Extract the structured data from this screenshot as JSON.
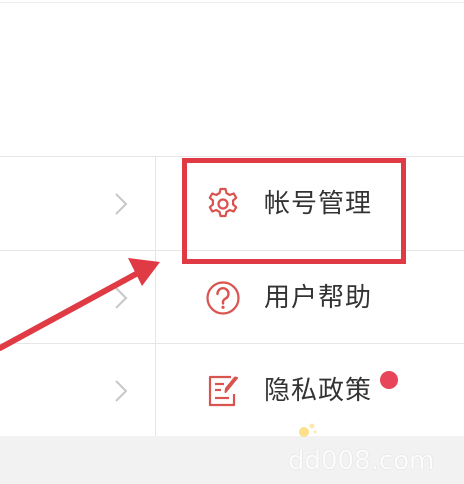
{
  "menu": {
    "items": [
      {
        "label": "帐号管理",
        "icon": "gear-icon",
        "highlighted": true
      },
      {
        "label": "用户帮助",
        "icon": "help-circle-icon"
      },
      {
        "label": "隐私政策",
        "icon": "document-edit-icon",
        "badge": "red-dot"
      }
    ]
  },
  "colors": {
    "accent": "#d9534f",
    "highlight": "#e03a44",
    "badge": "#e8455a"
  },
  "watermark": {
    "text": "dd008.com"
  }
}
